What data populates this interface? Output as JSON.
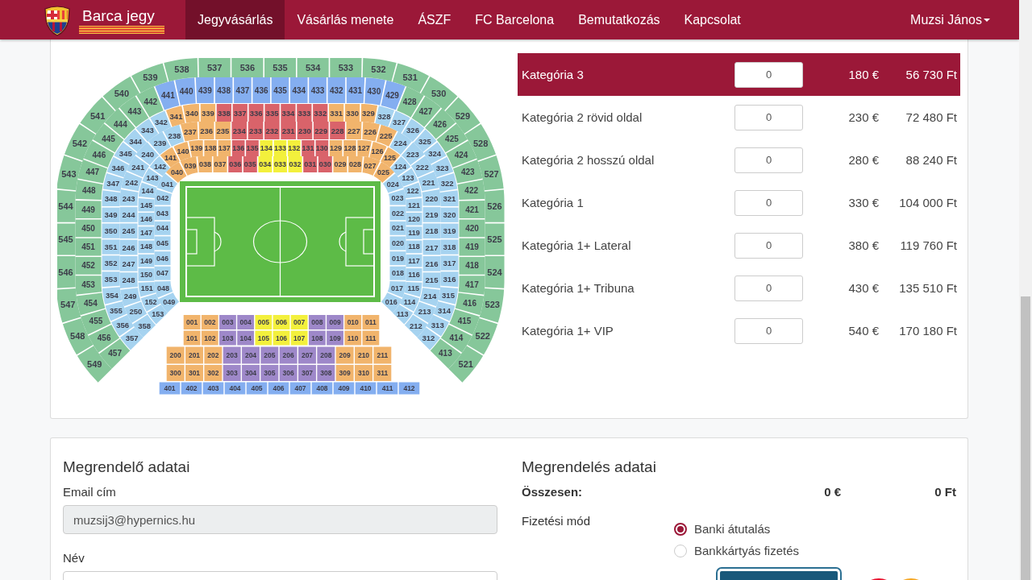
{
  "navbar": {
    "brand": "Barca jegy",
    "items": [
      {
        "label": "Jegyvásárlás",
        "selected": true
      },
      {
        "label": "Vásárlás menete",
        "selected": false
      },
      {
        "label": "ÁSZF",
        "selected": false
      },
      {
        "label": "FC Barcelona",
        "selected": false
      },
      {
        "label": "Bemutatkozás",
        "selected": false
      },
      {
        "label": "Kapcsolat",
        "selected": false
      }
    ],
    "user": "Muzsi János"
  },
  "seat_map": {
    "rings": [
      {
        "left": [
          {
            "color": "#f1b46c",
            "sections": [
              "040"
            ]
          },
          {
            "color": "#a6d3f0",
            "sections": [
              "041",
              "042",
              "043",
              "044",
              "045",
              "046",
              "047",
              "048",
              "049"
            ]
          }
        ],
        "top": [
          {
            "color": "#f1b46c",
            "sections": [
              "039",
              "038",
              "037"
            ]
          },
          {
            "color": "#d9636a",
            "sections": [
              "036",
              "035"
            ]
          },
          {
            "color": "#f3f03c",
            "sections": [
              "034",
              "033",
              "032"
            ]
          },
          {
            "color": "#d9636a",
            "sections": [
              "031",
              "030"
            ]
          },
          {
            "color": "#f1b46c",
            "sections": [
              "029",
              "028",
              "027"
            ]
          }
        ],
        "right": [
          {
            "color": "#f1b46c",
            "sections": [
              "025"
            ]
          },
          {
            "color": "#a6d3f0",
            "sections": [
              "024",
              "023",
              "022",
              "021",
              "020",
              "019",
              "018",
              "017",
              "016"
            ]
          }
        ]
      },
      {
        "left": [
          {
            "color": "#f1b46c",
            "sections": [
              "141"
            ]
          },
          {
            "color": "#a6d3f0",
            "sections": [
              "142",
              "143",
              "144",
              "145",
              "146",
              "147",
              "148",
              "149",
              "150",
              "151",
              "152",
              "153"
            ]
          }
        ],
        "top": [
          {
            "color": "#f1b46c",
            "sections": [
              "140",
              "139",
              "138",
              "137"
            ]
          },
          {
            "color": "#d9636a",
            "sections": [
              "136",
              "135"
            ]
          },
          {
            "color": "#f3f03c",
            "sections": [
              "134",
              "133",
              "132"
            ]
          },
          {
            "color": "#d9636a",
            "sections": [
              "131",
              "130"
            ]
          },
          {
            "color": "#f1b46c",
            "sections": [
              "129",
              "128",
              "127",
              "126"
            ]
          }
        ],
        "right": [
          {
            "color": "#f1b46c",
            "sections": [
              "125"
            ]
          },
          {
            "color": "#a6d3f0",
            "sections": [
              "124",
              "123",
              "122",
              "121",
              "120",
              "119",
              "118",
              "117",
              "116",
              "115",
              "114",
              "113"
            ]
          }
        ]
      },
      {
        "left": [
          {
            "color": "#a6d3f0",
            "sections": [
              "238",
              "239",
              "240",
              "241",
              "242",
              "243",
              "244",
              "245",
              "246",
              "247",
              "248",
              "249",
              "250",
              "358"
            ]
          }
        ],
        "top": [
          {
            "color": "#f1b46c",
            "sections": [
              "237",
              "236",
              "235"
            ]
          },
          {
            "color": "#d9636a",
            "sections": [
              "234",
              "233",
              "232",
              "231",
              "230",
              "229",
              "228"
            ]
          },
          {
            "color": "#f1b46c",
            "sections": [
              "227",
              "226"
            ]
          }
        ],
        "right": [
          {
            "color": "#f1b46c",
            "sections": [
              "225"
            ]
          },
          {
            "color": "#a6d3f0",
            "sections": [
              "224",
              "223",
              "222",
              "221",
              "220",
              "219",
              "218",
              "217",
              "216",
              "215",
              "214",
              "213",
              "212"
            ]
          }
        ]
      },
      {
        "left": [
          {
            "color": "#a6d3f0",
            "sections": [
              "342",
              "343",
              "344",
              "345",
              "346",
              "347",
              "348",
              "349",
              "350",
              "351",
              "352",
              "353",
              "354",
              "355",
              "356",
              "357"
            ]
          }
        ],
        "top": [
          {
            "color": "#f1b46c",
            "sections": [
              "341",
              "340",
              "339"
            ]
          },
          {
            "color": "#d9636a",
            "sections": [
              "338",
              "337",
              "336",
              "335",
              "334",
              "333",
              "332"
            ]
          },
          {
            "color": "#f1b46c",
            "sections": [
              "331",
              "330",
              "329"
            ]
          },
          {
            "color": "#a6d3f0",
            "sections": [
              "328"
            ]
          }
        ],
        "right": [
          {
            "color": "#a6d3f0",
            "sections": [
              "327",
              "326",
              "325",
              "324",
              "323",
              "322",
              "321",
              "320",
              "319",
              "318",
              "317",
              "316",
              "315",
              "314",
              "313",
              "312"
            ]
          }
        ]
      },
      {
        "left": [
          {
            "color": "#86c79a",
            "sections": [
              "442",
              "443",
              "444",
              "445",
              "446",
              "447",
              "448",
              "449",
              "450",
              "451",
              "452",
              "453",
              "454",
              "455",
              "456",
              "457"
            ]
          }
        ],
        "top": [
          {
            "color": "#84aef0",
            "sections": [
              "441",
              "440",
              "439",
              "438",
              "437",
              "436",
              "435",
              "434",
              "433",
              "432",
              "431",
              "430",
              "429"
            ]
          }
        ],
        "right": [
          {
            "color": "#86c79a",
            "sections": [
              "428",
              "427",
              "426",
              "425",
              "424",
              "423",
              "422",
              "421",
              "420",
              "419",
              "418",
              "417",
              "416",
              "415",
              "414",
              "413"
            ]
          }
        ]
      },
      {
        "left": [
          {
            "color": "#86c79a",
            "sections": [
              "540",
              "541",
              "542",
              "543",
              "544",
              "545",
              "546",
              "547",
              "548",
              "549"
            ]
          }
        ],
        "top": [
          {
            "color": "#86c79a",
            "sections": [
              "539",
              "538",
              "537",
              "536",
              "535",
              "534",
              "533",
              "532",
              "531"
            ]
          }
        ],
        "right": [
          {
            "color": "#86c79a",
            "sections": [
              "530",
              "529",
              "528",
              "527",
              "526",
              "525",
              "524",
              "523",
              "522",
              "521"
            ]
          }
        ]
      }
    ],
    "rows": [
      {
        "segments": [
          {
            "color": "#f1b46c",
            "sections": [
              "001",
              "002"
            ]
          },
          {
            "color": "#9e88c9",
            "sections": [
              "003",
              "004"
            ]
          },
          {
            "color": "#f3f03c",
            "sections": [
              "005",
              "006",
              "007"
            ]
          },
          {
            "color": "#9e88c9",
            "sections": [
              "008",
              "009"
            ]
          },
          {
            "color": "#f1b46c",
            "sections": [
              "010",
              "011"
            ]
          }
        ]
      },
      {
        "segments": [
          {
            "color": "#f1b46c",
            "sections": [
              "101",
              "102"
            ]
          },
          {
            "color": "#9e88c9",
            "sections": [
              "103",
              "104"
            ]
          },
          {
            "color": "#f3f03c",
            "sections": [
              "105",
              "106",
              "107"
            ]
          },
          {
            "color": "#9e88c9",
            "sections": [
              "108",
              "109"
            ]
          },
          {
            "color": "#f1b46c",
            "sections": [
              "110",
              "111"
            ]
          }
        ]
      },
      {
        "segments": [
          {
            "color": "#f1b46c",
            "sections": [
              "200",
              "201",
              "202"
            ]
          },
          {
            "color": "#9e88c9",
            "sections": [
              "203",
              "204",
              "205",
              "206",
              "207",
              "208"
            ]
          },
          {
            "color": "#f1b46c",
            "sections": [
              "209",
              "210",
              "211"
            ]
          }
        ]
      },
      {
        "segments": [
          {
            "color": "#f1b46c",
            "sections": [
              "300",
              "301",
              "302"
            ]
          },
          {
            "color": "#9e88c9",
            "sections": [
              "303",
              "304",
              "305",
              "306",
              "307",
              "308"
            ]
          },
          {
            "color": "#f1b46c",
            "sections": [
              "309",
              "310",
              "311"
            ]
          }
        ]
      },
      {
        "segments": [
          {
            "color": "#84aef0",
            "sections": [
              "401",
              "402",
              "403",
              "404",
              "405",
              "406",
              "407",
              "408",
              "409",
              "410",
              "411",
              "412"
            ]
          }
        ]
      }
    ]
  },
  "categories": [
    {
      "name": "Kategória 3",
      "selected": true,
      "quantity": "0",
      "price_eur": "180 €",
      "price_huf": "56 730 Ft"
    },
    {
      "name": "Kategória 2 rövid oldal",
      "selected": false,
      "quantity": "0",
      "price_eur": "230 €",
      "price_huf": "72 480 Ft"
    },
    {
      "name": "Kategória 2 hosszú oldal",
      "selected": false,
      "quantity": "0",
      "price_eur": "280 €",
      "price_huf": "88 240 Ft"
    },
    {
      "name": "Kategória 1",
      "selected": false,
      "quantity": "0",
      "price_eur": "330 €",
      "price_huf": "104 000 Ft"
    },
    {
      "name": "Kategória 1+ Lateral",
      "selected": false,
      "quantity": "0",
      "price_eur": "380 €",
      "price_huf": "119 760 Ft"
    },
    {
      "name": "Kategória 1+ Tribuna",
      "selected": false,
      "quantity": "0",
      "price_eur": "430 €",
      "price_huf": "135 510 Ft"
    },
    {
      "name": "Kategória 1+ VIP",
      "selected": false,
      "quantity": "0",
      "price_eur": "540 €",
      "price_huf": "170 180 Ft"
    }
  ],
  "orderer": {
    "title": "Megrendelő adatai",
    "fields": [
      {
        "label": "Email cím",
        "value": "muzsij3@hypernics.hu",
        "disabled": true
      },
      {
        "label": "Név",
        "disabled": false
      }
    ]
  },
  "order": {
    "title": "Megrendelés adatai",
    "total_label": "Összesen:",
    "total_eur": "0 €",
    "total_huf": "0 Ft",
    "payment_label": "Fizetési mód",
    "payment_options": [
      {
        "label": "Banki átutalás",
        "selected": true
      },
      {
        "label": "Bankkártyás fizetés",
        "selected": false
      }
    ]
  }
}
